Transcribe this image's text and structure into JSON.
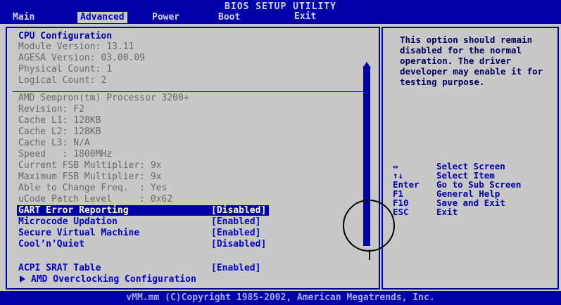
{
  "header": {
    "title": "BIOS SETUP UTILITY",
    "tabs": [
      "Main",
      "Advanced",
      "Power",
      "Boot",
      "Exit"
    ],
    "active_tab": "Advanced"
  },
  "cpu": {
    "heading": "CPU Configuration",
    "info": [
      "Module Version: 13.11",
      "AGESA Version: 03.00.09",
      "Physical Count: 1",
      "Logical Count: 2"
    ],
    "details": [
      "AMD Sempron(tm) Processor 3200+",
      "Revision: F2",
      "Cache L1: 128KB",
      "Cache L2: 128KB",
      "Cache L3: N/A",
      "Speed   : 1800MHz",
      "Current FSB Multiplier: 9x",
      "Maximum FSB Multiplier: 9x",
      "Able to Change Freq.  : Yes",
      "uCode Patch Level     : 0x62"
    ]
  },
  "settings": [
    {
      "label": "GART Error Reporting",
      "value": "[Disabled]"
    },
    {
      "label": "Microcode Updation",
      "value": "[Enabled]"
    },
    {
      "label": "Secure Virtual Machine",
      "value": "[Enabled]"
    },
    {
      "label": "Cool’n’Quiet",
      "value": "[Disabled]"
    }
  ],
  "lower": {
    "acpi_label": "ACPI SRAT Table",
    "acpi_value": "[Enabled]",
    "overclock_label": "AMD Overclocking Configuration"
  },
  "help": {
    "text": "This option should remain disabled for the normal operation. The driver developer may enable it for testing purpose.",
    "keys": [
      {
        "key": "↔",
        "desc": "Select Screen"
      },
      {
        "key": "↑↓",
        "desc": "Select Item"
      },
      {
        "key": "Enter",
        "desc": "Go to Sub Screen"
      },
      {
        "key": "F1",
        "desc": "General Help"
      },
      {
        "key": "F10",
        "desc": "Save and Exit"
      },
      {
        "key": "ESC",
        "desc": "Exit"
      }
    ]
  },
  "footer": {
    "text": "vMM.mm (C)Copyright 1985-2002, American Megatrends, Inc."
  },
  "colors": {
    "bios_blue": "#0000a8",
    "panel_grey": "#c8c8c8",
    "text_grey": "#6a6a6a"
  }
}
